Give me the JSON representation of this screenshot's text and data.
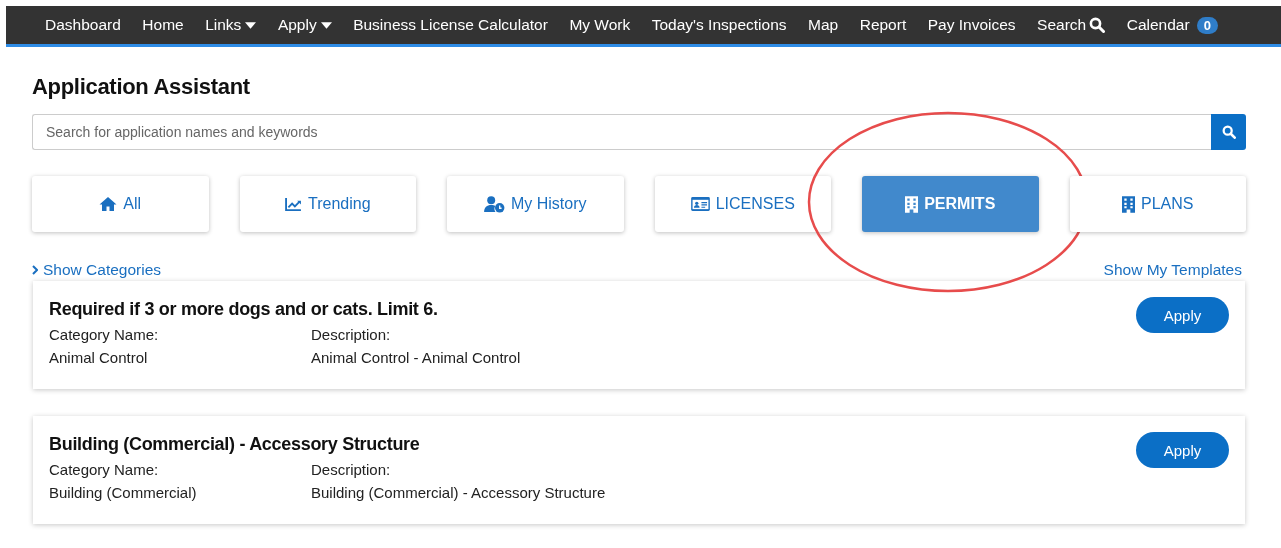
{
  "nav": [
    {
      "label": "Dashboard",
      "kind": "link"
    },
    {
      "label": "Home",
      "kind": "link"
    },
    {
      "label": "Links",
      "kind": "dropdown"
    },
    {
      "label": "Apply",
      "kind": "dropdown"
    },
    {
      "label": "Business License Calculator",
      "kind": "link"
    },
    {
      "label": "My Work",
      "kind": "link"
    },
    {
      "label": "Today's Inspections",
      "kind": "link"
    },
    {
      "label": "Map",
      "kind": "link"
    },
    {
      "label": "Report",
      "kind": "link"
    },
    {
      "label": "Pay Invoices",
      "kind": "link"
    },
    {
      "label": "Search",
      "kind": "search"
    },
    {
      "label": "Calendar",
      "kind": "badge",
      "badge": "0"
    }
  ],
  "title": "Application Assistant",
  "search": {
    "placeholder": "Search for application names and keywords"
  },
  "tabs": [
    {
      "label": "All",
      "kind": "home",
      "selected": false,
      "circled": false
    },
    {
      "label": "Trending",
      "kind": "chart",
      "selected": false,
      "circled": false
    },
    {
      "label": "My History",
      "kind": "history",
      "selected": false,
      "circled": false
    },
    {
      "label": "LICENSES",
      "kind": "license",
      "selected": false,
      "circled": false
    },
    {
      "label": "PERMITS",
      "kind": "permit",
      "selected": true,
      "circled": true
    },
    {
      "label": "PLANS",
      "kind": "plan",
      "selected": false,
      "circled": false
    }
  ],
  "show_categories": "Show Categories",
  "show_templates": "Show My Templates",
  "applications": [
    {
      "title": "Required if 3 or more dogs and or cats. Limit 6.",
      "category_label": "Category Name:",
      "category": "Animal Control",
      "description_label": "Description:",
      "description": "Animal Control - Animal Control",
      "button": "Apply"
    },
    {
      "title": "Building (Commercial) - Accessory Structure",
      "category_label": "Category Name:",
      "category": "Building (Commercial)",
      "description_label": "Description:",
      "description": "Building (Commercial) - Accessory Structure",
      "button": "Apply"
    }
  ]
}
